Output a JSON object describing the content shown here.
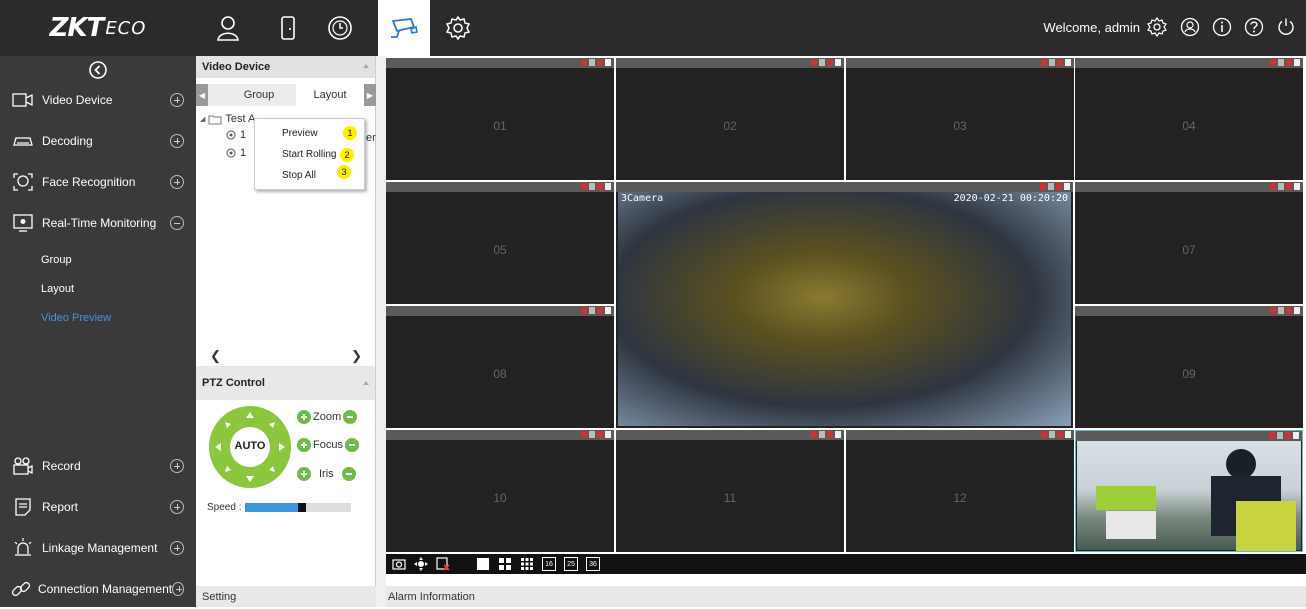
{
  "header": {
    "logo_main": "ZKT",
    "logo_sub": "ECO",
    "welcome": "Welcome, admin",
    "nav_icons": [
      "person-icon",
      "door-icon",
      "clock-icon",
      "camera-icon",
      "gear-icon"
    ],
    "right_icons": [
      "settings-icon",
      "user-circle-icon",
      "info-icon",
      "help-icon",
      "power-icon"
    ]
  },
  "sidebar": {
    "items": [
      {
        "label": "Video Device",
        "icon": "video-icon",
        "expanded": false
      },
      {
        "label": "Decoding",
        "icon": "decoder-icon",
        "expanded": false
      },
      {
        "label": "Face Recognition",
        "icon": "face-icon",
        "expanded": false
      },
      {
        "label": "Real-Time Monitoring",
        "icon": "monitor-icon",
        "expanded": true
      },
      {
        "label": "Record",
        "icon": "record-icon",
        "expanded": false
      },
      {
        "label": "Report",
        "icon": "report-icon",
        "expanded": false
      },
      {
        "label": "Linkage Management",
        "icon": "alarm-icon",
        "expanded": false
      },
      {
        "label": "Connection Management",
        "icon": "link-icon",
        "expanded": false
      }
    ],
    "sub_items": [
      "Group",
      "Layout",
      "Video Preview"
    ],
    "selected_sub": "Video Preview"
  },
  "video_device_panel": {
    "title": "Video Device",
    "tabs": [
      "Group",
      "Layout"
    ],
    "active_tab": "Layout",
    "tree_root": "Test A",
    "tree_children": [
      "1",
      "1"
    ],
    "truncated_tail": "er"
  },
  "context_menu": {
    "items": [
      {
        "label": "Preview",
        "badge": "1"
      },
      {
        "label": "Start Rolling",
        "badge": "2"
      },
      {
        "label": "Stop All",
        "badge": "3"
      }
    ]
  },
  "ptz": {
    "title": "PTZ Control",
    "auto_label": "AUTO",
    "controls": [
      "Zoom",
      "Focus",
      "Iris"
    ],
    "speed_label": "Speed :",
    "speed_level": 0.5
  },
  "bottom": {
    "setting": "Setting",
    "alarm": "Alarm Information"
  },
  "video": {
    "cells": [
      "01",
      "02",
      "03",
      "04",
      "05",
      "07",
      "08",
      "09",
      "10",
      "11",
      "12"
    ],
    "big_camera_label": "3Camera",
    "big_camera_timestamp": "2020-02-21 00:20:20",
    "toolbar_layouts": [
      "16",
      "25",
      "36"
    ]
  },
  "colors": {
    "topbar": "#2b2b2b",
    "sidebar": "#3a3a3a",
    "selected_link": "#4a90e2",
    "ptz_green": "#8cc63f",
    "badge_yellow": "#ffee00"
  }
}
